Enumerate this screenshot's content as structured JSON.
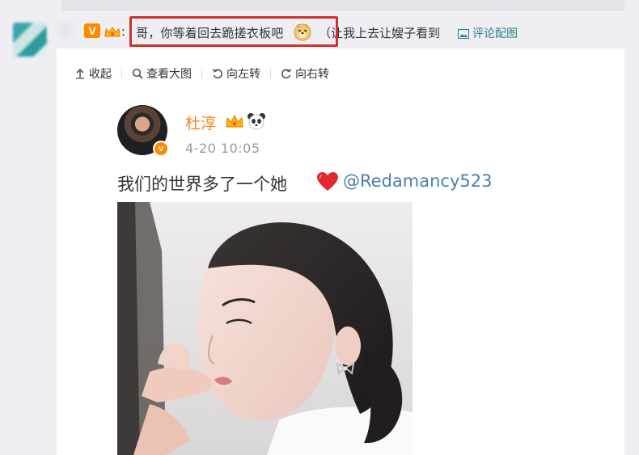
{
  "comment": {
    "vip_badge": "V",
    "colon": ":",
    "text_highlighted": "哥，你等着回去跪搓衣板吧",
    "text_rest": "（让我上去让嫂子看到",
    "picture_comment": "评论配图"
  },
  "toolbar": {
    "collapse": "收起",
    "view_large": "查看大图",
    "rotate_left": "向左转",
    "rotate_right": "向右转"
  },
  "post": {
    "author": "杜淳",
    "verified_badge": "v",
    "time": "4-20 10:05",
    "text": "我们的世界多了一个她",
    "mention": "@Redamancy523"
  },
  "colors": {
    "highlight_border": "#d0312d",
    "author_name": "#ff7f19",
    "mention": "#4a7fb0",
    "link": "#2f7f8f",
    "badge": "#ff8a00"
  }
}
